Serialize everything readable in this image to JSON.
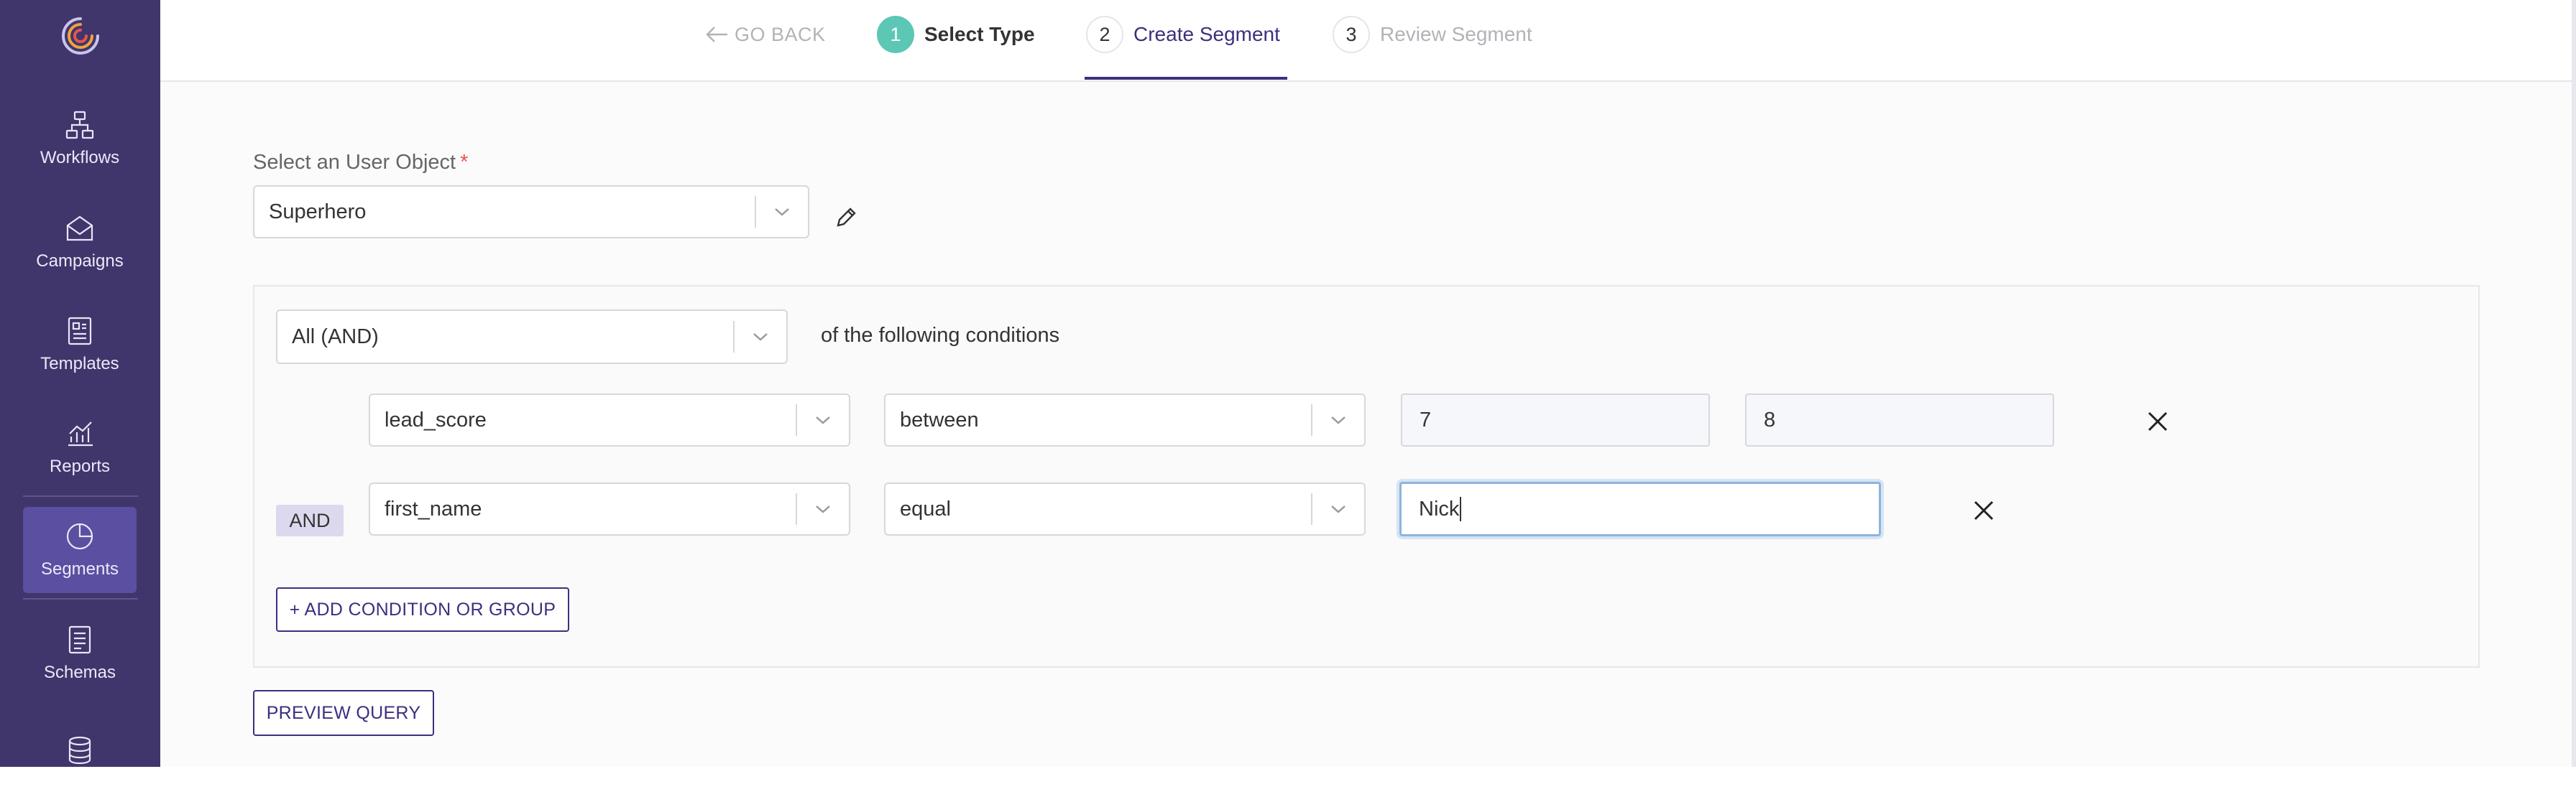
{
  "sidebar": {
    "items": [
      {
        "label": "Workflows",
        "icon": "workflows-icon"
      },
      {
        "label": "Campaigns",
        "icon": "campaigns-icon"
      },
      {
        "label": "Templates",
        "icon": "templates-icon"
      },
      {
        "label": "Reports",
        "icon": "reports-icon"
      },
      {
        "label": "Segments",
        "icon": "segments-icon",
        "active": true
      },
      {
        "label": "Schemas",
        "icon": "schemas-icon"
      },
      {
        "label": "",
        "icon": "database-icon"
      }
    ]
  },
  "header": {
    "go_back": "GO BACK",
    "steps": [
      {
        "number": "1",
        "label": "Select Type",
        "state": "completed"
      },
      {
        "number": "2",
        "label": "Create Segment",
        "state": "active"
      },
      {
        "number": "3",
        "label": "Review Segment",
        "state": "upcoming"
      }
    ]
  },
  "user_object": {
    "label": "Select an User Object",
    "required_mark": "*",
    "value": "Superhero"
  },
  "group": {
    "operator": "All (AND)",
    "suffix": "of the following conditions",
    "conditions": [
      {
        "connector": "",
        "field": "lead_score",
        "operator": "between",
        "value1": "7",
        "value2": "8"
      },
      {
        "connector": "AND",
        "field": "first_name",
        "operator": "equal",
        "value1": "Nick"
      }
    ],
    "add_button": "+ ADD CONDITION OR GROUP"
  },
  "preview_button": "PREVIEW QUERY",
  "colors": {
    "sidebar_bg": "#40366c",
    "sidebar_active": "#5a4fa0",
    "accent": "#3f2e7e",
    "step_complete": "#5cc7b5",
    "required": "#e5554f"
  }
}
